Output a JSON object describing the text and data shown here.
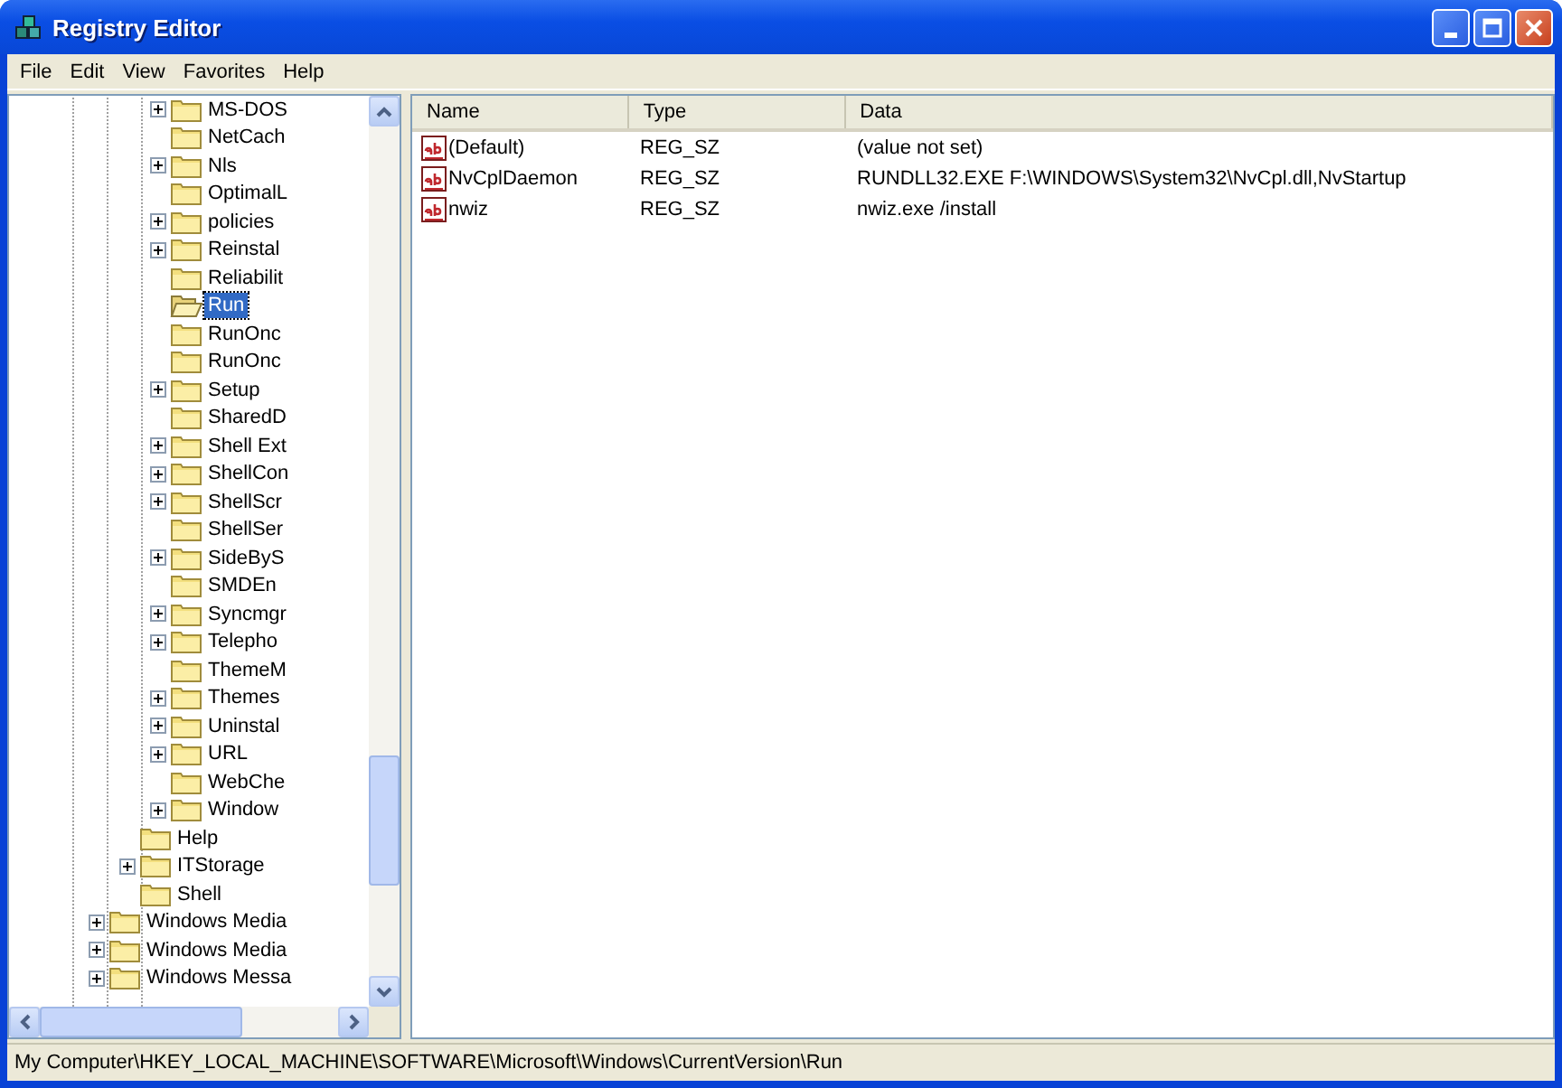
{
  "window": {
    "title": "Registry Editor"
  },
  "menu": [
    "File",
    "Edit",
    "View",
    "Favorites",
    "Help"
  ],
  "tree": {
    "items": [
      {
        "children": [
          {
            "children": [
              {
                "label": "MS-DOS",
                "expandable": true,
                "selected": false
              },
              {
                "label": "NetCach",
                "expandable": false,
                "selected": false
              },
              {
                "label": "Nls",
                "expandable": true,
                "selected": false
              },
              {
                "label": "OptimalL",
                "expandable": false,
                "selected": false
              },
              {
                "label": "policies",
                "expandable": true,
                "selected": false
              },
              {
                "label": "Reinstal",
                "expandable": true,
                "selected": false
              },
              {
                "label": "Reliabilit",
                "expandable": false,
                "selected": false
              },
              {
                "label": "Run",
                "expandable": false,
                "selected": true
              },
              {
                "label": "RunOnc",
                "expandable": false,
                "selected": false
              },
              {
                "label": "RunOnc",
                "expandable": false,
                "selected": false
              },
              {
                "label": "Setup",
                "expandable": true,
                "selected": false
              },
              {
                "label": "SharedD",
                "expandable": false,
                "selected": false
              },
              {
                "label": "Shell Ext",
                "expandable": true,
                "selected": false
              },
              {
                "label": "ShellCon",
                "expandable": true,
                "selected": false
              },
              {
                "label": "ShellScr",
                "expandable": true,
                "selected": false
              },
              {
                "label": "ShellSer",
                "expandable": false,
                "selected": false
              },
              {
                "label": "SideByS",
                "expandable": true,
                "selected": false
              },
              {
                "label": "SMDEn",
                "expandable": false,
                "selected": false
              },
              {
                "label": "Syncmgr",
                "expandable": true,
                "selected": false
              },
              {
                "label": "Telepho",
                "expandable": true,
                "selected": false
              },
              {
                "label": "ThemeM",
                "expandable": false,
                "selected": false
              },
              {
                "label": "Themes",
                "expandable": true,
                "selected": false
              },
              {
                "label": "Uninstal",
                "expandable": true,
                "selected": false
              },
              {
                "label": "URL",
                "expandable": true,
                "selected": false
              },
              {
                "label": "WebChe",
                "expandable": false,
                "selected": false
              },
              {
                "label": "Window",
                "expandable": true,
                "selected": false
              }
            ]
          },
          {
            "label": "Help",
            "expandable": false,
            "selected": false
          },
          {
            "label": "ITStorage",
            "expandable": true,
            "selected": false
          },
          {
            "label": "Shell",
            "expandable": false,
            "selected": false
          }
        ]
      },
      {
        "label": "Windows Media",
        "expandable": true,
        "selected": false
      },
      {
        "label": "Windows Media",
        "expandable": true,
        "selected": false
      },
      {
        "label": "Windows Messa",
        "expandable": true,
        "selected": false
      }
    ]
  },
  "values": {
    "columns": [
      "Name",
      "Type",
      "Data"
    ],
    "rows": [
      {
        "name": "(Default)",
        "type": "REG_SZ",
        "data": "(value not set)"
      },
      {
        "name": "NvCplDaemon",
        "type": "REG_SZ",
        "data": "RUNDLL32.EXE F:\\WINDOWS\\System32\\NvCpl.dll,NvStartup"
      },
      {
        "name": "nwiz",
        "type": "REG_SZ",
        "data": "nwiz.exe /install"
      }
    ]
  },
  "status_bar": "My Computer\\HKEY_LOCAL_MACHINE\\SOFTWARE\\Microsoft\\Windows\\CurrentVersion\\Run"
}
